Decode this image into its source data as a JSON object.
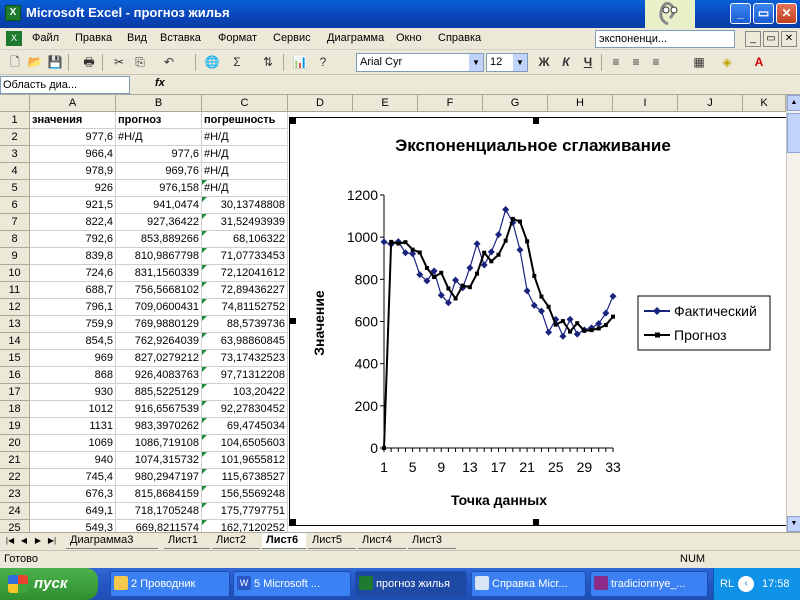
{
  "window": {
    "title": "Microsoft Excel - прогноз жилья",
    "minimize": "_",
    "restore": "▭",
    "close": "✕"
  },
  "menu": {
    "items": [
      "Файл",
      "Правка",
      "Вид",
      "Вставка",
      "Формат",
      "Сервис",
      "Диаграмма",
      "Окно",
      "Справка"
    ],
    "help_box": "экспоненци..."
  },
  "toolbar": {
    "font": "Arial Cyr",
    "size": "12",
    "bold": "Ж",
    "italic": "К",
    "underline": "Ч"
  },
  "formula": {
    "namebox": "Область диа...",
    "fx": "fx"
  },
  "sheet": {
    "columns": [
      "A",
      "B",
      "C",
      "D",
      "E",
      "F",
      "G",
      "H",
      "I",
      "J",
      "K"
    ],
    "header": [
      "значения",
      "прогноз",
      "погрешность"
    ],
    "rows": [
      {
        "n": "1",
        "a": "значения",
        "b": "прогноз",
        "c": "погрешность"
      },
      {
        "n": "2",
        "a": "977,6",
        "b": "#Н/Д",
        "c": "#Н/Д"
      },
      {
        "n": "3",
        "a": "966,4",
        "b": "977,6",
        "c": "#Н/Д"
      },
      {
        "n": "4",
        "a": "978,9",
        "b": "969,76",
        "c": "#Н/Д"
      },
      {
        "n": "5",
        "a": "926",
        "b": "976,158",
        "c": "#Н/Д"
      },
      {
        "n": "6",
        "a": "921,5",
        "b": "941,0474",
        "c": "30,13748808"
      },
      {
        "n": "7",
        "a": "822,4",
        "b": "927,36422",
        "c": "31,52493939"
      },
      {
        "n": "8",
        "a": "792,6",
        "b": "853,889266",
        "c": "68,106322"
      },
      {
        "n": "9",
        "a": "839,8",
        "b": "810,9867798",
        "c": "71,07733453"
      },
      {
        "n": "10",
        "a": "724,6",
        "b": "831,1560339",
        "c": "72,12041612"
      },
      {
        "n": "11",
        "a": "688,7",
        "b": "756,5668102",
        "c": "72,89436227"
      },
      {
        "n": "12",
        "a": "796,1",
        "b": "709,0600431",
        "c": "74,81152752"
      },
      {
        "n": "13",
        "a": "759,9",
        "b": "769,9880129",
        "c": "88,5739736"
      },
      {
        "n": "14",
        "a": "854,5",
        "b": "762,9264039",
        "c": "63,98860845"
      },
      {
        "n": "15",
        "a": "969",
        "b": "827,0279212",
        "c": "73,17432523"
      },
      {
        "n": "16",
        "a": "868",
        "b": "926,4083763",
        "c": "97,71312208"
      },
      {
        "n": "17",
        "a": "930",
        "b": "885,5225129",
        "c": "103,20422"
      },
      {
        "n": "18",
        "a": "1012",
        "b": "916,6567539",
        "c": "92,27830452"
      },
      {
        "n": "19",
        "a": "1131",
        "b": "983,3970262",
        "c": "69,4745034"
      },
      {
        "n": "20",
        "a": "1069",
        "b": "1086,719108",
        "c": "104,6505603"
      },
      {
        "n": "21",
        "a": "940",
        "b": "1074,315732",
        "c": "101,9655812"
      },
      {
        "n": "22",
        "a": "745,4",
        "b": "980,2947197",
        "c": "115,6738527"
      },
      {
        "n": "23",
        "a": "676,3",
        "b": "815,8684159",
        "c": "156,5569248"
      },
      {
        "n": "24",
        "a": "649,1",
        "b": "718,1705248",
        "c": "175,7797751"
      },
      {
        "n": "25",
        "a": "549,3",
        "b": "669,8211574",
        "c": "162,7120252"
      }
    ]
  },
  "tabs": [
    "Диаграмма3",
    "Лист1",
    "Лист2",
    "Лист6",
    "Лист5",
    "Лист4",
    "Лист3"
  ],
  "active_tab": "Лист6",
  "status": {
    "left": "Готово",
    "right": "NUM"
  },
  "taskbar": {
    "start": "пуск",
    "tasks": [
      "2 Проводник",
      "5 Microsoft ...",
      "прогноз жилья",
      "Справка Micr...",
      "tradicionnye_..."
    ],
    "lang": "RL",
    "clock": "17:58"
  },
  "chart_data": {
    "type": "line",
    "title": "Экспоненциальное сглаживание",
    "xlabel": "Точка данных",
    "ylabel": "Значение",
    "ylim": [
      0,
      1200
    ],
    "yticks": [
      "0",
      "200",
      "400",
      "600",
      "800",
      "1000",
      "1200"
    ],
    "xticks": [
      "1",
      "5",
      "9",
      "13",
      "17",
      "21",
      "25",
      "29",
      "33"
    ],
    "legend_position": "right",
    "series": [
      {
        "name": "Фактический",
        "color": "#1a237e",
        "marker": "diamond",
        "values": [
          977.6,
          966.4,
          978.9,
          926,
          921.5,
          822.4,
          792.6,
          839.8,
          724.6,
          688.7,
          796.1,
          759.9,
          854.5,
          969,
          868,
          930,
          1012,
          1131,
          1069,
          940,
          745.4,
          676.3,
          649.1,
          549.3,
          610,
          530,
          610,
          540,
          560,
          570,
          590,
          640,
          720
        ]
      },
      {
        "name": "Прогноз",
        "color": "#000000",
        "marker": "square",
        "values": [
          0,
          977.6,
          969.76,
          976.158,
          941.0474,
          927.36422,
          853.889266,
          810.9867798,
          831.1560339,
          756.5668102,
          709.0600431,
          769.9880129,
          762.9264039,
          827.0279212,
          926.4083763,
          885.5225129,
          916.6567539,
          983.3970262,
          1086.719108,
          1074.315732,
          980.2947197,
          815.8684159,
          718.1705248,
          669.8211574,
          585,
          602,
          552,
          592,
          556,
          559,
          567,
          583,
          623
        ]
      }
    ]
  }
}
